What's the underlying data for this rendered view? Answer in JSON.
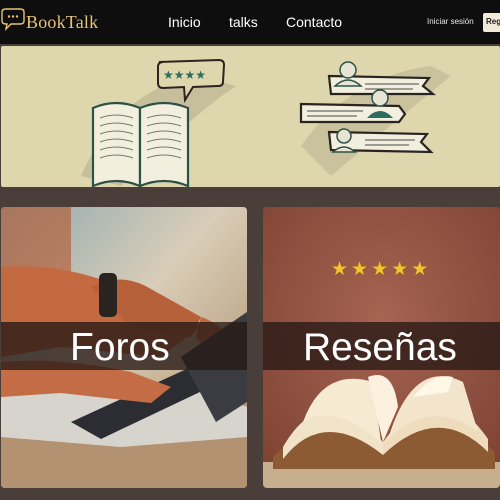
{
  "brand": {
    "name": "BookTalk"
  },
  "nav": {
    "links": [
      "Inicio",
      "talks",
      "Contacto"
    ],
    "login_label": "Iniciar sesión",
    "register_label": "Reg"
  },
  "hero": {
    "rating_stars": 4
  },
  "cards": [
    {
      "label": "Foros"
    },
    {
      "label": "Reseñas",
      "rating_stars": 5
    }
  ],
  "colors": {
    "nav_bg": "#0e0e0e",
    "brand_gold": "#e7c277",
    "hero_bg": "#ded6ad",
    "page_bg": "#4a3e3b",
    "star_gold": "#f2c230"
  }
}
